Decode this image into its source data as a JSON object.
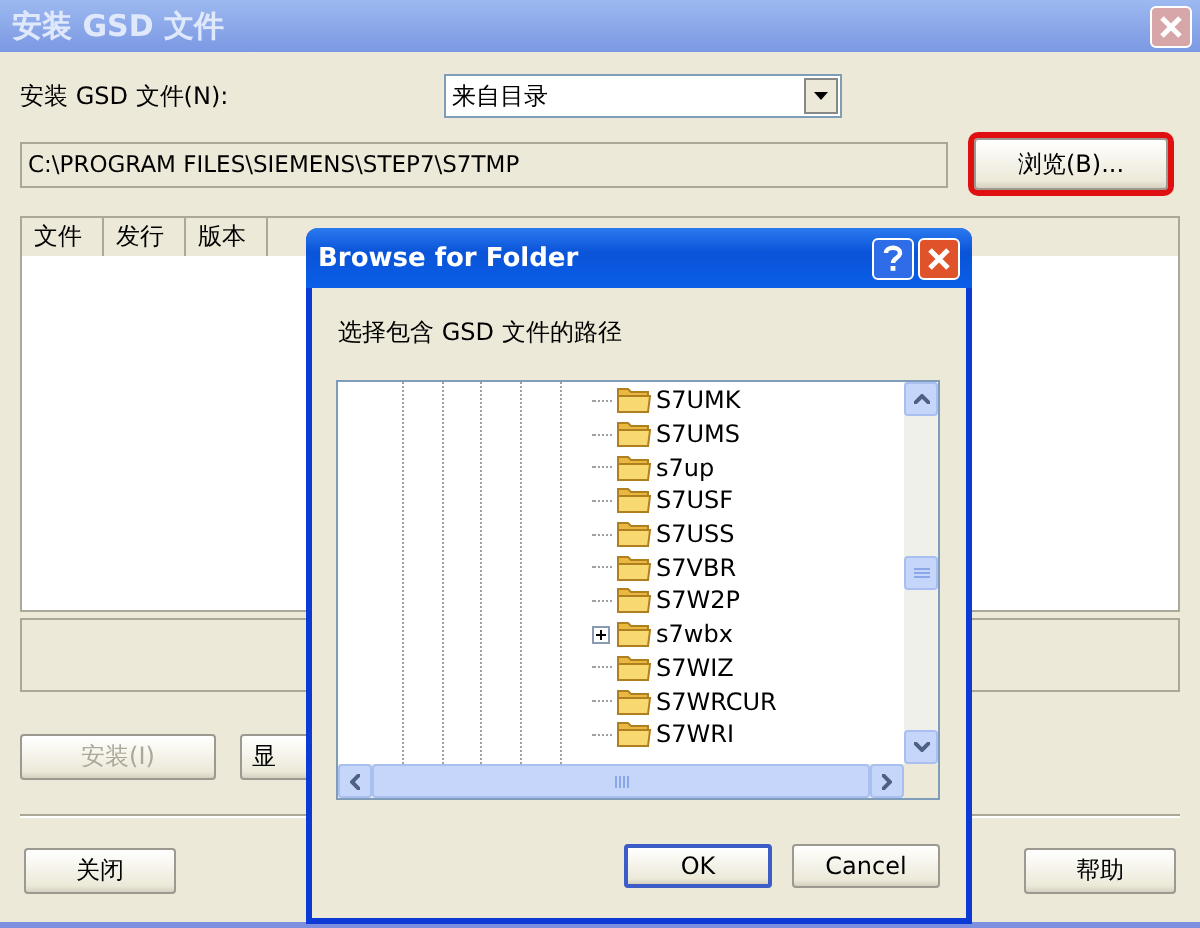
{
  "main_window": {
    "title": "安装 GSD 文件",
    "install_label": "安装 GSD 文件(N):",
    "source_combo": {
      "value": "来自目录"
    },
    "path_field": {
      "value": "C:\\PROGRAM FILES\\SIEMENS\\STEP7\\S7TMP"
    },
    "browse_button": {
      "label": "浏览(B)...",
      "highlighted": true
    },
    "table": {
      "columns": [
        "文件",
        "发行",
        "版本"
      ]
    },
    "action_buttons": [
      {
        "label": "安装(I)",
        "disabled": true
      },
      {
        "label": "显",
        "disabled": false
      }
    ],
    "bottom_buttons": [
      {
        "label": "关闭"
      },
      {
        "label": "帮助"
      }
    ]
  },
  "browse_dialog": {
    "title": "Browse for Folder",
    "prompt": "选择包含 GSD 文件的路径",
    "folders": [
      {
        "name": "S7UMK",
        "expandable": false
      },
      {
        "name": "S7UMS",
        "expandable": false
      },
      {
        "name": "s7up",
        "expandable": false
      },
      {
        "name": "S7USF",
        "expandable": false
      },
      {
        "name": "S7USS",
        "expandable": false
      },
      {
        "name": "S7VBR",
        "expandable": false
      },
      {
        "name": "S7W2P",
        "expandable": false
      },
      {
        "name": "s7wbx",
        "expandable": true
      },
      {
        "name": "S7WIZ",
        "expandable": false
      },
      {
        "name": "S7WRCUR",
        "expandable": false
      },
      {
        "name": "S7WRI",
        "expandable": false
      }
    ],
    "buttons": [
      {
        "label": "OK",
        "default": true
      },
      {
        "label": "Cancel",
        "default": false
      }
    ]
  }
}
